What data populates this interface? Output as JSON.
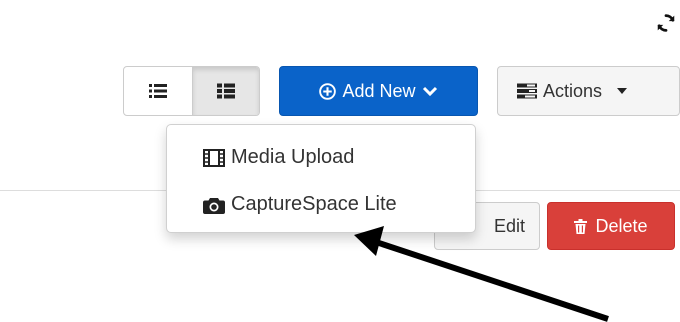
{
  "toolbar": {
    "refresh_icon": "refresh-icon",
    "view_toggle": [
      {
        "icon": "list-view-icon",
        "active": false
      },
      {
        "icon": "detailed-list-view-icon",
        "active": true
      }
    ],
    "add_new": {
      "label": "Add New",
      "icon": "plus-circle-icon",
      "caret": "chevron-down-icon",
      "color": "#0a63c9"
    },
    "actions": {
      "label": "Actions",
      "icon": "tasks-icon",
      "caret": "caret-down-icon"
    }
  },
  "add_new_menu": {
    "items": [
      {
        "label": "Media Upload",
        "icon": "film-icon"
      },
      {
        "label": "CaptureSpace Lite",
        "icon": "camera-icon"
      }
    ]
  },
  "entry_actions": {
    "edit": {
      "label": "Edit"
    },
    "delete": {
      "label": "Delete",
      "icon": "trash-icon",
      "color": "#d9403a"
    }
  },
  "annotation": {
    "icon": "pointer-arrow",
    "color": "#000000"
  }
}
